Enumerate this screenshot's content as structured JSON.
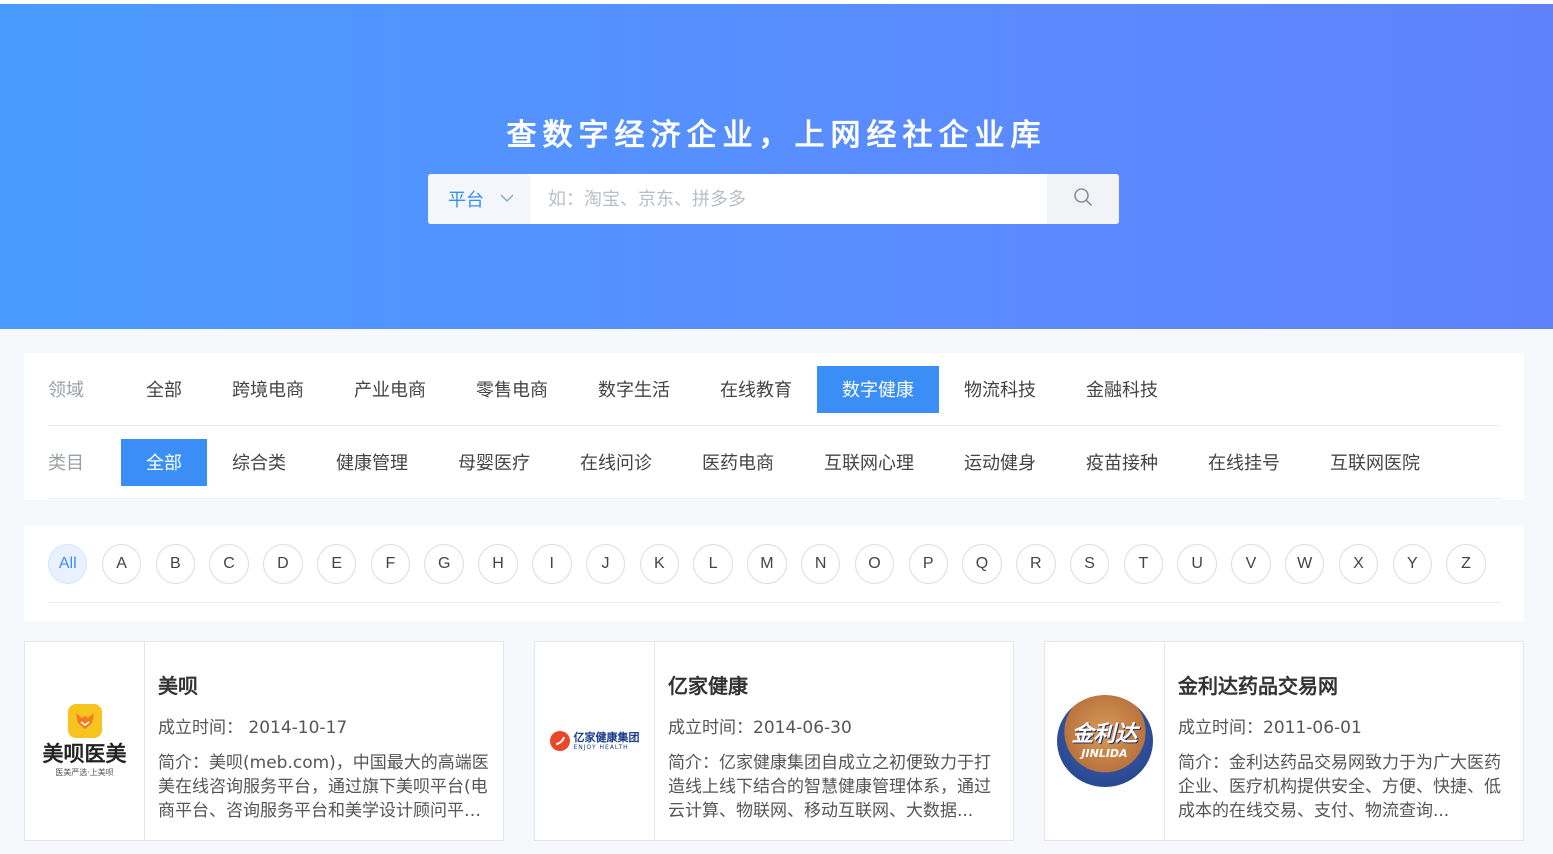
{
  "hero": {
    "title": "查数字经济企业，上网经社企业库",
    "search_type": "平台",
    "search_placeholder": "如：淘宝、京东、拼多多"
  },
  "filters": {
    "domain_label": "领域",
    "domains": [
      "全部",
      "跨境电商",
      "产业电商",
      "零售电商",
      "数字生活",
      "在线教育",
      "数字健康",
      "物流科技",
      "金融科技"
    ],
    "domain_active": "数字健康",
    "category_label": "类目",
    "categories": [
      "全部",
      "综合类",
      "健康管理",
      "母婴医疗",
      "在线问诊",
      "医药电商",
      "互联网心理",
      "运动健身",
      "疫苗接种",
      "在线挂号",
      "互联网医院"
    ],
    "category_active": "全部"
  },
  "alphabet": [
    "All",
    "A",
    "B",
    "C",
    "D",
    "E",
    "F",
    "G",
    "H",
    "I",
    "J",
    "K",
    "L",
    "M",
    "N",
    "O",
    "P",
    "Q",
    "R",
    "S",
    "T",
    "U",
    "V",
    "W",
    "X",
    "Y",
    "Z"
  ],
  "alphabet_active": "All",
  "companies": [
    {
      "name": "美呗",
      "founded_label": "成立时间：",
      "founded": "2014-10-17",
      "desc": "简介：美呗(meb.com)，中国最大的高端医美在线咨询服务平台，通过旗下美呗平台(电商平台、咨询服务平台和美学设计顾问平台)...",
      "logo_text": "美呗医美",
      "logo_sub": "医美严选·上美呗"
    },
    {
      "name": "亿家健康",
      "founded_label": "成立时间：",
      "founded": "2014-06-30",
      "desc": "简介：亿家健康集团自成立之初便致力于打造线上线下结合的智慧健康管理体系，通过云计算、物联网、移动互联网、大数据...",
      "logo_text": "亿家健康集团",
      "logo_sub": "ENJOY HEALTH"
    },
    {
      "name": "金利达药品交易网",
      "founded_label": "成立时间：",
      "founded": "2011-06-01",
      "desc": "简介：金利达药品交易网致力于为广大医药企业、医疗机构提供安全、方便、快捷、低成本的在线交易、支付、物流查询...",
      "logo_text": "金利达",
      "logo_sub": "JINLIDA"
    }
  ],
  "colors": {
    "accent": "#3a8ef6",
    "hero_start": "#4a9bff",
    "hero_end": "#5f82fb"
  }
}
